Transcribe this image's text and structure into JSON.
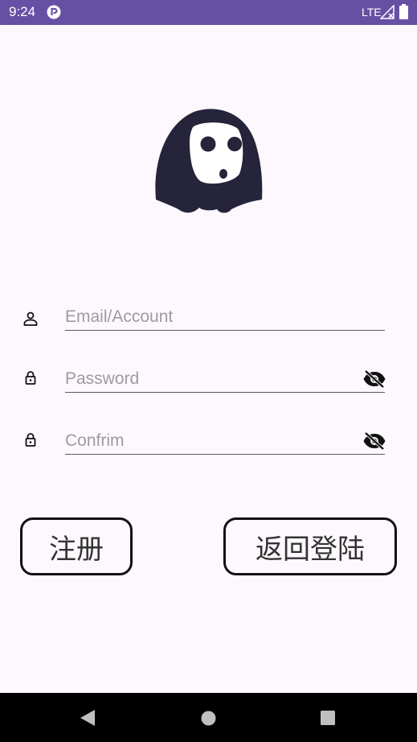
{
  "status_bar": {
    "time": "9:24",
    "network": "LTE",
    "color": "#6650a4"
  },
  "logo": {
    "icon": "no-face-mask-icon",
    "color": "#25243a"
  },
  "form": {
    "email": {
      "placeholder": "Email/Account",
      "value": "",
      "icon": "person-icon"
    },
    "password": {
      "placeholder": "Password",
      "value": "",
      "icon": "lock-icon",
      "toggle_icon": "eye-off-icon"
    },
    "confirm": {
      "placeholder": "Confrim",
      "value": "",
      "icon": "lock-icon",
      "toggle_icon": "eye-off-icon"
    }
  },
  "buttons": {
    "register": "注册",
    "back_to_login": "返回登陆"
  },
  "nav_bar": {
    "back_icon": "triangle-back-icon",
    "home_icon": "circle-home-icon",
    "recents_icon": "square-recents-icon"
  }
}
